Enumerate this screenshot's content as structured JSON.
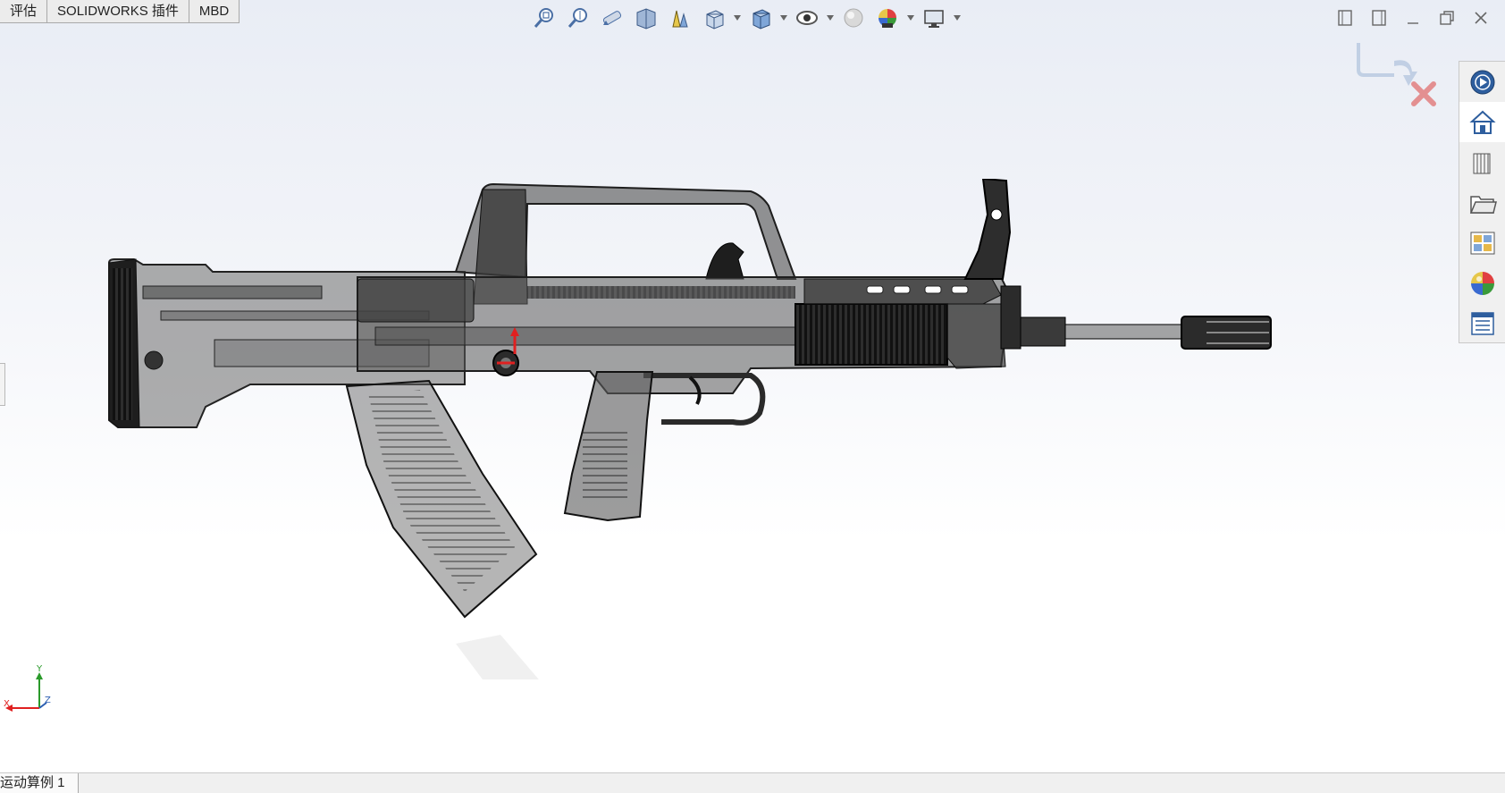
{
  "tabs": [
    {
      "label": "评估"
    },
    {
      "label": "SOLIDWORKS 插件"
    },
    {
      "label": "MBD"
    }
  ],
  "heads_up_toolbar": [
    {
      "icon": "zoom-to-fit-icon",
      "has_dropdown": false
    },
    {
      "icon": "zoom-to-area-icon",
      "has_dropdown": false
    },
    {
      "icon": "previous-view-icon",
      "has_dropdown": false
    },
    {
      "icon": "section-view-icon",
      "has_dropdown": false
    },
    {
      "icon": "dynamic-annotation-views-icon",
      "has_dropdown": false
    },
    {
      "icon": "view-orientation-icon",
      "has_dropdown": true
    },
    {
      "icon": "display-style-icon",
      "has_dropdown": true
    },
    {
      "icon": "hide-show-items-icon",
      "has_dropdown": true
    },
    {
      "icon": "edit-appearance-icon",
      "has_dropdown": false
    },
    {
      "icon": "apply-scene-icon",
      "has_dropdown": true
    },
    {
      "icon": "view-settings-icon",
      "has_dropdown": true
    }
  ],
  "window_controls": [
    "tile-left-icon",
    "tile-right-icon",
    "minimize-icon",
    "restore-icon",
    "close-icon"
  ],
  "task_pane": [
    {
      "icon": "solidworks-resources-icon",
      "active": false
    },
    {
      "icon": "home-icon",
      "active": true
    },
    {
      "icon": "design-library-icon",
      "active": false
    },
    {
      "icon": "file-explorer-icon",
      "active": false
    },
    {
      "icon": "view-palette-icon",
      "active": false
    },
    {
      "icon": "appearances-scenes-icon",
      "active": false
    },
    {
      "icon": "custom-properties-icon",
      "active": false
    }
  ],
  "triad": {
    "y_label": "Y",
    "x_label": "X",
    "z_label": "Z"
  },
  "bottom_tabs": [
    {
      "label": "运动算例 1"
    }
  ],
  "colors": {
    "viewport_top": "#e9edf5",
    "viewport_bottom": "#ffffff",
    "model_body": "#3a3a3a",
    "model_transparent": "#6b6b6b",
    "accent_red": "#e02020",
    "accent_blue": "#2a5db0"
  }
}
